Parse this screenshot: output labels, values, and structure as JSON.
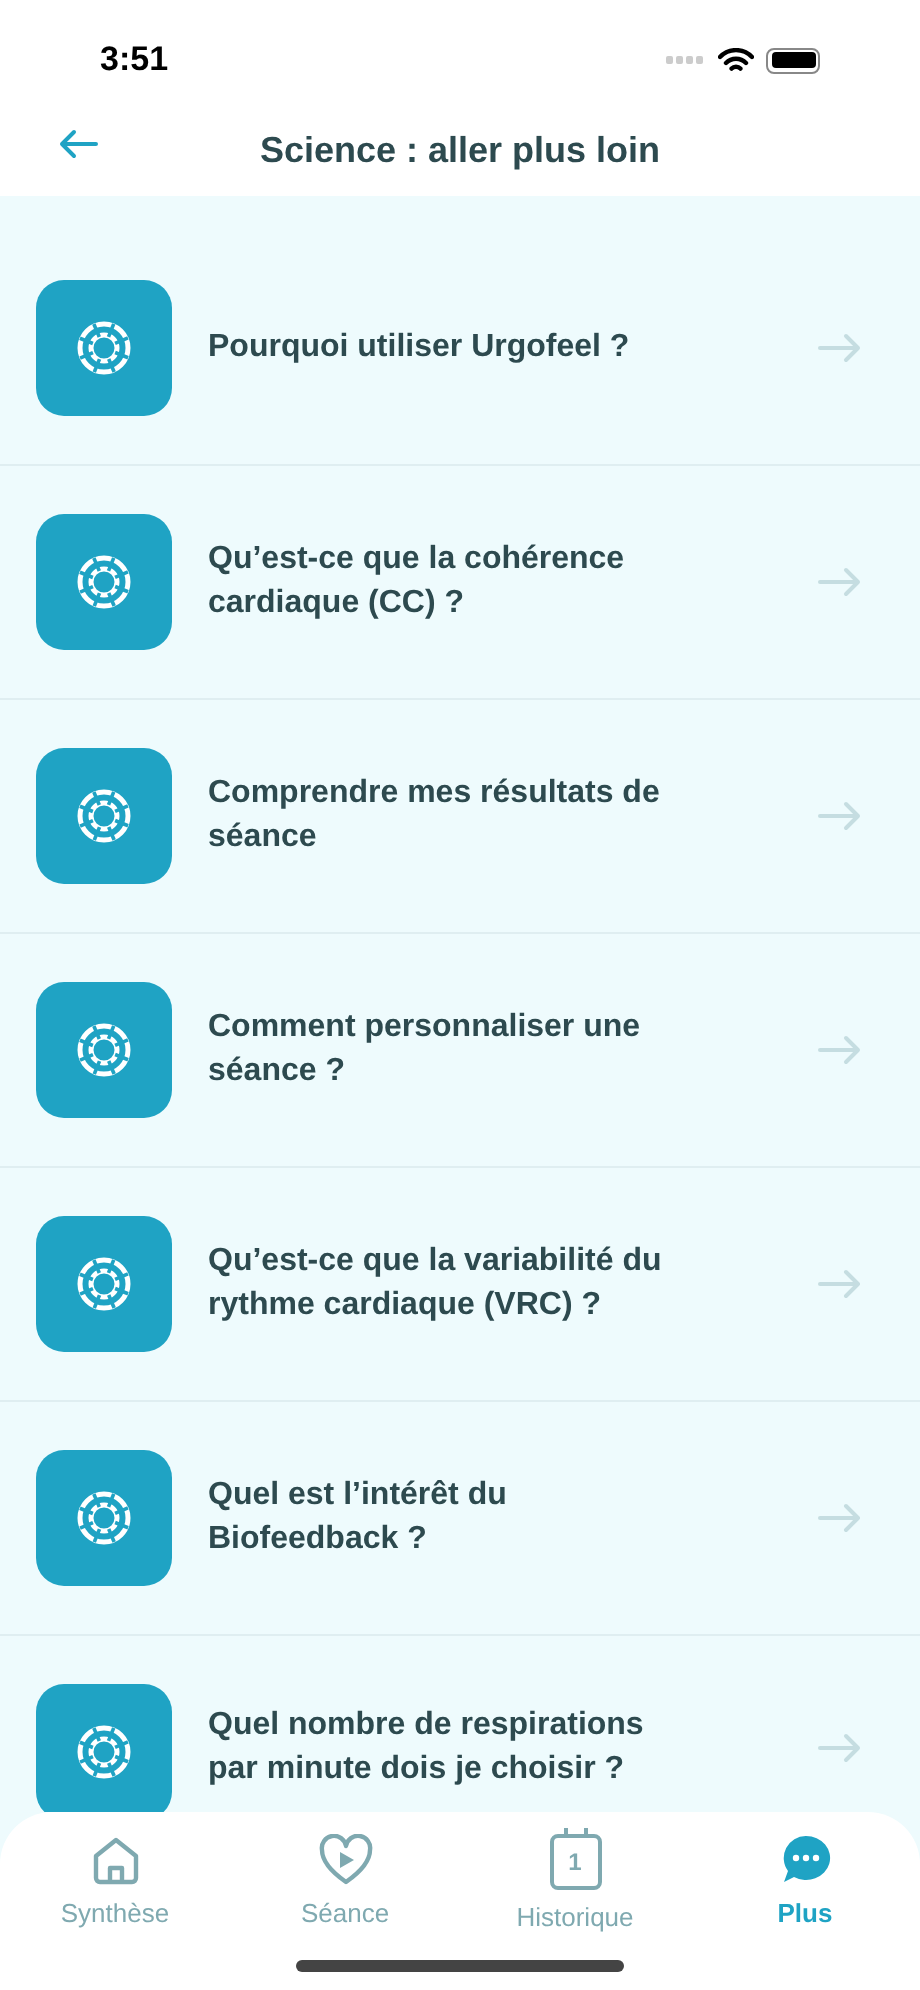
{
  "status_bar": {
    "time": "3:51"
  },
  "header": {
    "title": "Science : aller plus loin"
  },
  "items": [
    {
      "label": "Pourquoi utiliser Urgofeel ?"
    },
    {
      "label": "Qu’est-ce que la cohérence cardiaque (CC) ?"
    },
    {
      "label": "Comprendre mes résultats de séance"
    },
    {
      "label": "Comment personnaliser une séance ?"
    },
    {
      "label": "Qu’est-ce que la variabilité du rythme cardiaque (VRC) ?"
    },
    {
      "label": "Quel est l’intérêt du Biofeedback ?"
    },
    {
      "label": "Quel nombre de respirations par minute dois je choisir ?"
    }
  ],
  "tab_bar": [
    {
      "kind": "home",
      "label": "Synthèse",
      "selected": false
    },
    {
      "kind": "heart",
      "label": "Séance",
      "selected": false
    },
    {
      "kind": "calendar",
      "label": "Historique",
      "selected": false,
      "day": "1"
    },
    {
      "kind": "chat",
      "label": "Plus",
      "selected": true
    }
  ]
}
